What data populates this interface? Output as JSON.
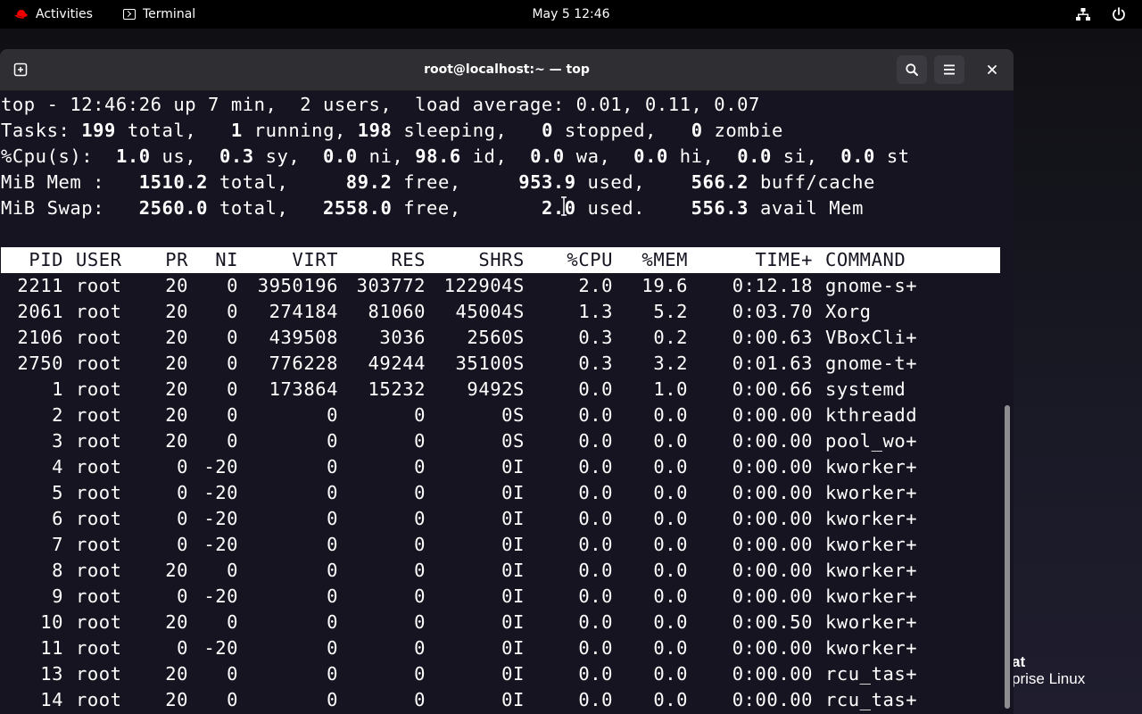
{
  "topbar": {
    "activities_label": "Activities",
    "app_label": "Terminal",
    "clock": "May 5  12:46"
  },
  "desktop": {
    "brand_line1": "at",
    "brand_line2": "prise Linux"
  },
  "window": {
    "title": "root@localhost:~ — top"
  },
  "summary": {
    "line1": "top - 12:46:26 up 7 min,  2 users,  load average: 0.01, 0.11, 0.07",
    "tasks": {
      "label": "Tasks:",
      "total": "199",
      "total_lbl": "total,",
      "running": "1",
      "running_lbl": "running,",
      "sleeping": "198",
      "sleeping_lbl": "sleeping,",
      "stopped": "0",
      "stopped_lbl": "stopped,",
      "zombie": "0",
      "zombie_lbl": "zombie"
    },
    "cpu": {
      "label": "%Cpu(s):",
      "us": "1.0",
      "sy": "0.3",
      "ni": "0.0",
      "id": "98.6",
      "wa": "0.0",
      "hi": "0.0",
      "si": "0.0",
      "st": "0.0"
    },
    "mem": {
      "label": "MiB Mem :",
      "total": "1510.2",
      "free": "89.2",
      "used": "953.9",
      "buff": "566.2"
    },
    "swap": {
      "label": "MiB Swap:",
      "total": "2560.0",
      "free": "2558.0",
      "used": "2.0",
      "avail": "556.3"
    }
  },
  "columns": [
    "PID",
    "USER",
    "PR",
    "NI",
    "VIRT",
    "RES",
    "SHR",
    "S",
    "%CPU",
    "%MEM",
    "TIME+",
    "COMMAND"
  ],
  "processes": [
    [
      "2211",
      "root",
      "20",
      "0",
      "3950196",
      "303772",
      "122904",
      "S",
      "2.0",
      "19.6",
      "0:12.18",
      "gnome-s+"
    ],
    [
      "2061",
      "root",
      "20",
      "0",
      "274184",
      "81060",
      "45004",
      "S",
      "1.3",
      "5.2",
      "0:03.70",
      "Xorg"
    ],
    [
      "2106",
      "root",
      "20",
      "0",
      "439508",
      "3036",
      "2560",
      "S",
      "0.3",
      "0.2",
      "0:00.63",
      "VBoxCli+"
    ],
    [
      "2750",
      "root",
      "20",
      "0",
      "776228",
      "49244",
      "35100",
      "S",
      "0.3",
      "3.2",
      "0:01.63",
      "gnome-t+"
    ],
    [
      "1",
      "root",
      "20",
      "0",
      "173864",
      "15232",
      "9492",
      "S",
      "0.0",
      "1.0",
      "0:00.66",
      "systemd"
    ],
    [
      "2",
      "root",
      "20",
      "0",
      "0",
      "0",
      "0",
      "S",
      "0.0",
      "0.0",
      "0:00.00",
      "kthreadd"
    ],
    [
      "3",
      "root",
      "20",
      "0",
      "0",
      "0",
      "0",
      "S",
      "0.0",
      "0.0",
      "0:00.00",
      "pool_wo+"
    ],
    [
      "4",
      "root",
      "0",
      "-20",
      "0",
      "0",
      "0",
      "I",
      "0.0",
      "0.0",
      "0:00.00",
      "kworker+"
    ],
    [
      "5",
      "root",
      "0",
      "-20",
      "0",
      "0",
      "0",
      "I",
      "0.0",
      "0.0",
      "0:00.00",
      "kworker+"
    ],
    [
      "6",
      "root",
      "0",
      "-20",
      "0",
      "0",
      "0",
      "I",
      "0.0",
      "0.0",
      "0:00.00",
      "kworker+"
    ],
    [
      "7",
      "root",
      "0",
      "-20",
      "0",
      "0",
      "0",
      "I",
      "0.0",
      "0.0",
      "0:00.00",
      "kworker+"
    ],
    [
      "8",
      "root",
      "20",
      "0",
      "0",
      "0",
      "0",
      "I",
      "0.0",
      "0.0",
      "0:00.00",
      "kworker+"
    ],
    [
      "9",
      "root",
      "0",
      "-20",
      "0",
      "0",
      "0",
      "I",
      "0.0",
      "0.0",
      "0:00.00",
      "kworker+"
    ],
    [
      "10",
      "root",
      "20",
      "0",
      "0",
      "0",
      "0",
      "I",
      "0.0",
      "0.0",
      "0:00.50",
      "kworker+"
    ],
    [
      "11",
      "root",
      "0",
      "-20",
      "0",
      "0",
      "0",
      "I",
      "0.0",
      "0.0",
      "0:00.00",
      "kworker+"
    ],
    [
      "13",
      "root",
      "20",
      "0",
      "0",
      "0",
      "0",
      "I",
      "0.0",
      "0.0",
      "0:00.00",
      "rcu_tas+"
    ],
    [
      "14",
      "root",
      "20",
      "0",
      "0",
      "0",
      "0",
      "I",
      "0.0",
      "0.0",
      "0:00.00",
      "rcu_tas+"
    ]
  ],
  "colors": {
    "topbar": "#000000",
    "titlebar": "#2e2e33",
    "terminal_bg": "#171421",
    "terminal_fg": "#ffffff",
    "brand_red": "#ee0000"
  }
}
